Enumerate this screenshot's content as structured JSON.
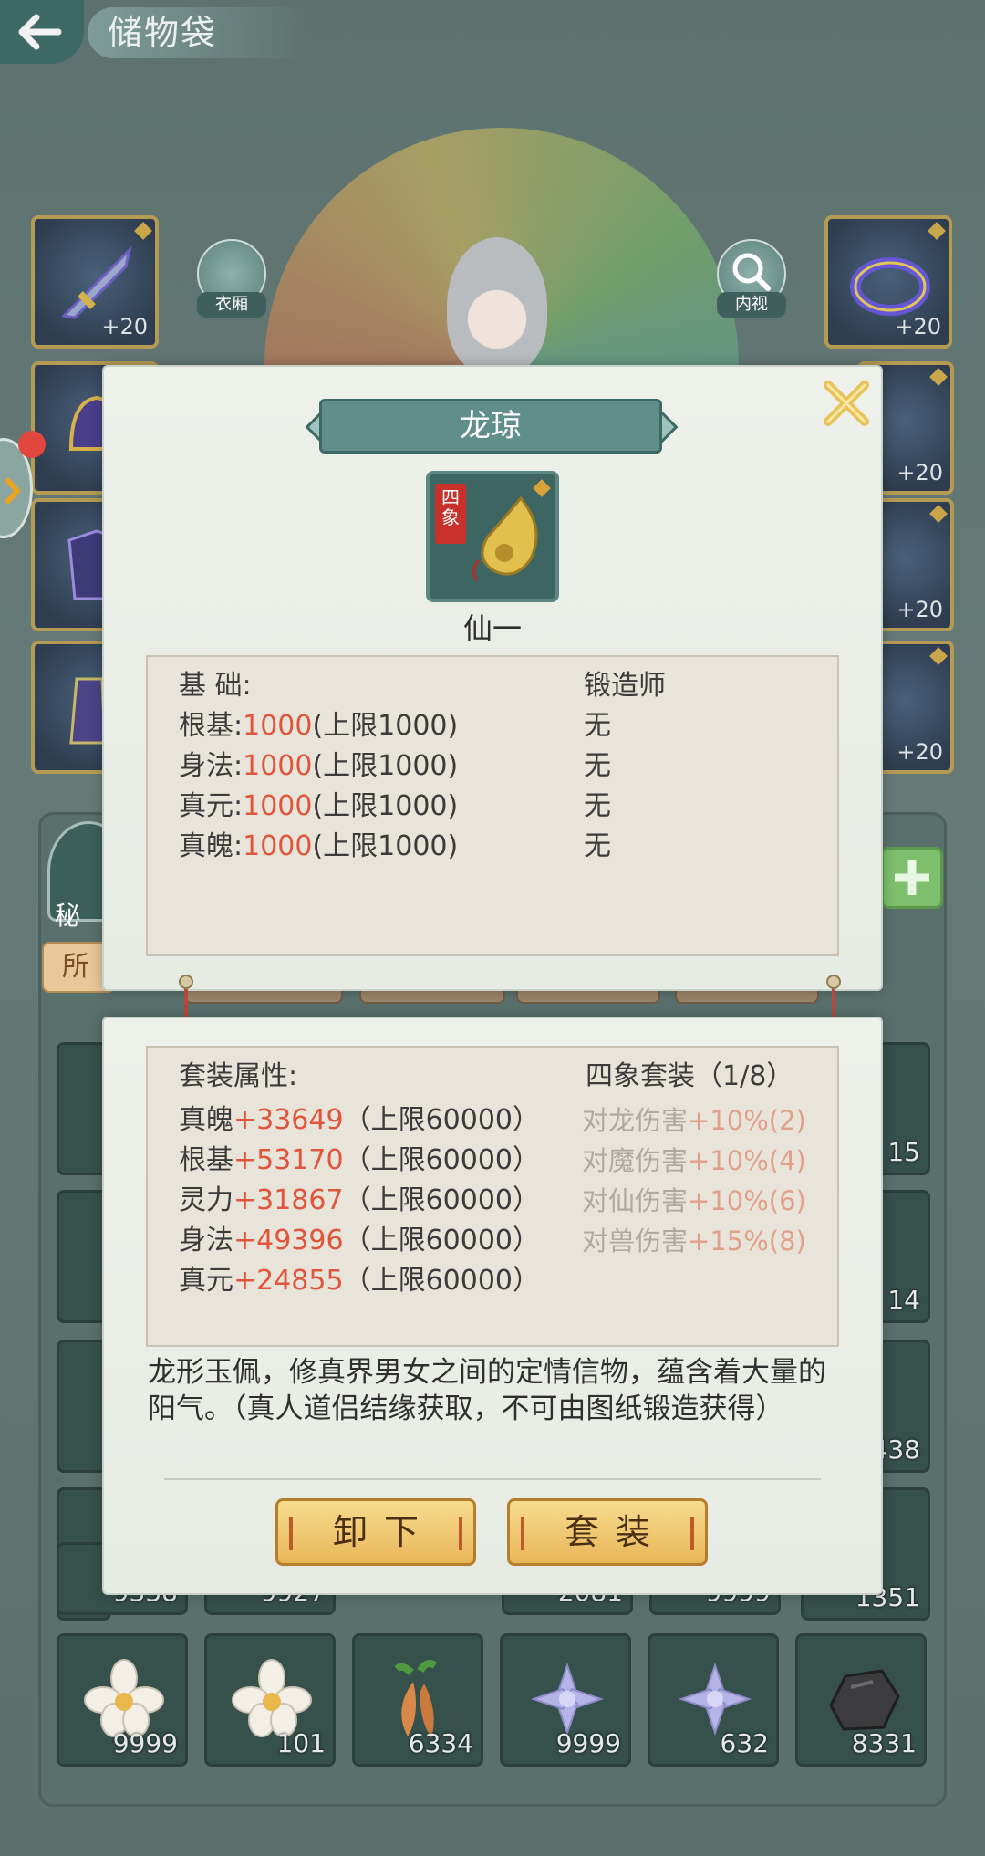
{
  "header": {
    "title": "储物袋"
  },
  "character_screen": {
    "wardrobe_label": "衣厢",
    "inspect_label": "内视",
    "equipment_slots": [
      {
        "plus": "+20"
      },
      {
        "plus": "+20"
      },
      {
        "plus": "+20"
      },
      {
        "plus": "+20"
      },
      {
        "plus": "+20"
      }
    ],
    "secret_label": "秘",
    "tab_first_label": "所"
  },
  "inventory": {
    "visible_counts": [
      "15",
      "14",
      "438",
      "1351",
      "9338",
      "9927",
      "2081",
      "9999"
    ],
    "bottom_row": [
      {
        "icon": "white-flower-icon",
        "count": "9999"
      },
      {
        "icon": "white-flower-icon",
        "count": "101"
      },
      {
        "icon": "root-herb-icon",
        "count": "6334"
      },
      {
        "icon": "lavender-succulent-icon",
        "count": "9999"
      },
      {
        "icon": "lavender-succulent-icon",
        "count": "632"
      },
      {
        "icon": "dark-ore-icon",
        "count": "8331"
      }
    ]
  },
  "item_detail": {
    "name": "龙琼",
    "seal_text": "四象",
    "grade": "仙一",
    "base": {
      "header": "基 础:",
      "smith_header": "锻造师",
      "stats": [
        {
          "name": "根基:",
          "value": "1000",
          "cap": "(上限1000)",
          "smith": "无"
        },
        {
          "name": "身法:",
          "value": "1000",
          "cap": "(上限1000)",
          "smith": "无"
        },
        {
          "name": "真元:",
          "value": "1000",
          "cap": "(上限1000)",
          "smith": "无"
        },
        {
          "name": "真魄:",
          "value": "1000",
          "cap": "(上限1000)",
          "smith": "无"
        }
      ]
    },
    "set": {
      "header": "套装属性:",
      "set_name": "四象套装（1/8）",
      "stats": [
        {
          "name": "真魄",
          "value": "+33649",
          "cap": "（上限60000）"
        },
        {
          "name": "根基",
          "value": "+53170",
          "cap": "（上限60000）"
        },
        {
          "name": "灵力",
          "value": "+31867",
          "cap": "（上限60000）"
        },
        {
          "name": "身法",
          "value": "+49396",
          "cap": "（上限60000）"
        },
        {
          "name": "真元",
          "value": "+24855",
          "cap": "（上限60000）"
        }
      ],
      "bonuses": [
        {
          "label": "对龙伤害",
          "value": "+10%(2)"
        },
        {
          "label": "对魔伤害",
          "value": "+10%(4)"
        },
        {
          "label": "对仙伤害",
          "value": "+10%(6)"
        },
        {
          "label": "对兽伤害",
          "value": "+15%(8)"
        }
      ]
    },
    "description": "龙形玉佩，修真界男女之间的定情信物，蕴含着大量的阳气。（真人道侣结缘获取，不可由图纸锻造获得）",
    "buttons": {
      "unequip": "卸下",
      "set": "套装"
    }
  },
  "colors": {
    "stat_value": "#e0563c",
    "dialog_bg": "#eef1ea",
    "banner": "#5f8f88",
    "button_gold": "#f0c770"
  }
}
